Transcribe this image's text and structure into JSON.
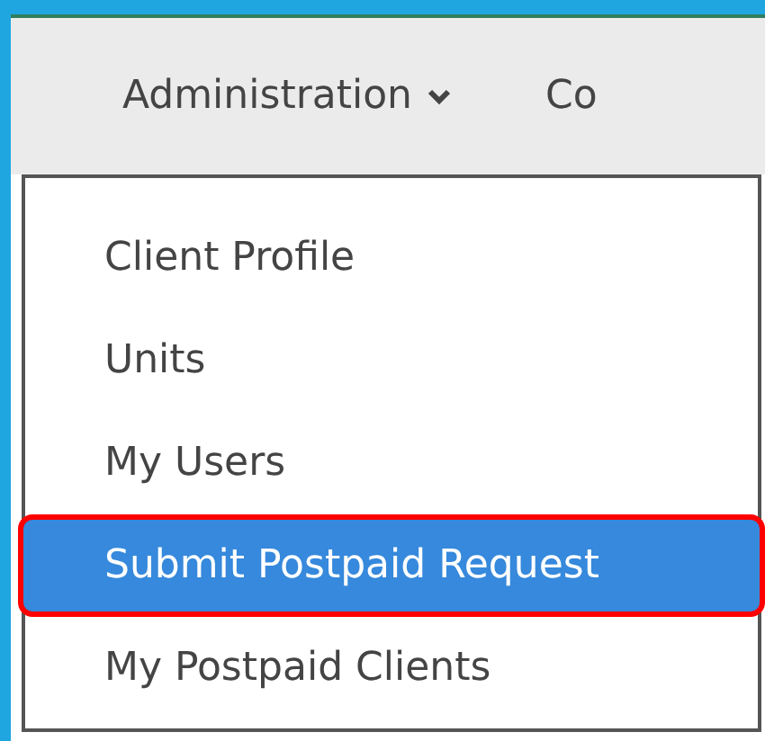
{
  "nav": {
    "items": [
      {
        "label": "Administration",
        "expanded": true
      },
      {
        "label": "Co",
        "expanded": false
      }
    ]
  },
  "menu": {
    "items": [
      {
        "label": "Client Profile",
        "selected": false,
        "callout": false
      },
      {
        "label": "Units",
        "selected": false,
        "callout": false
      },
      {
        "label": "My Users",
        "selected": false,
        "callout": false
      },
      {
        "label": "Submit Postpaid Request",
        "selected": true,
        "callout": true
      },
      {
        "label": "My Postpaid Clients",
        "selected": false,
        "callout": false
      }
    ]
  }
}
